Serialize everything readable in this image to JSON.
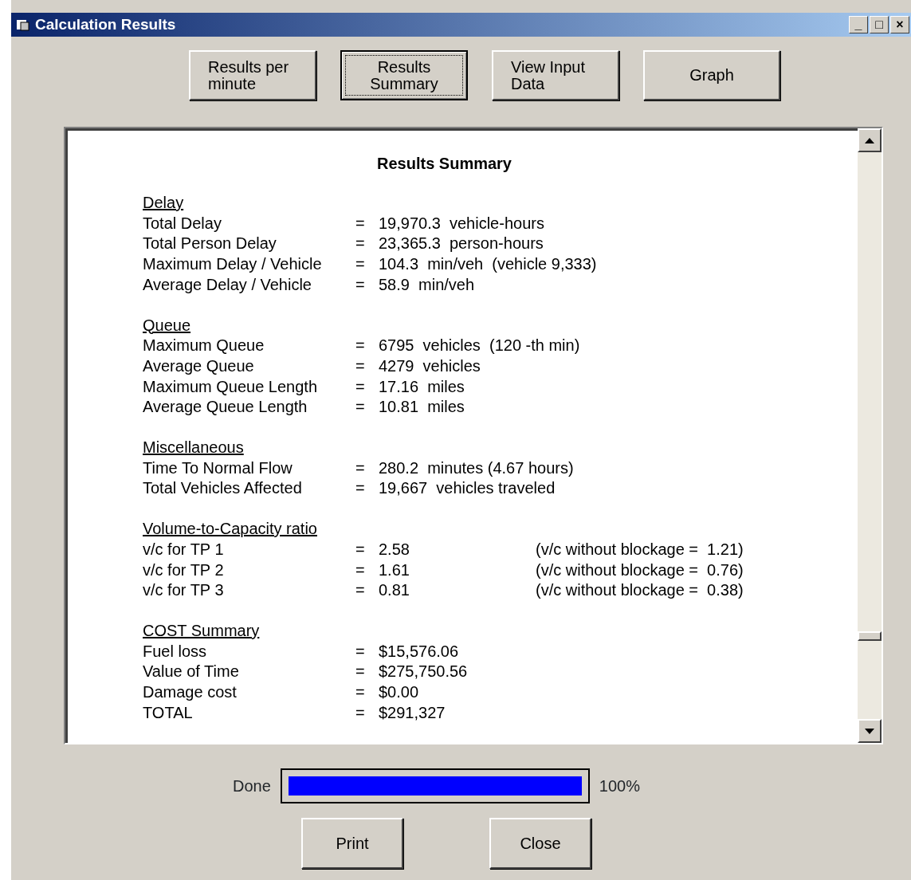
{
  "window": {
    "title": "Calculation Results",
    "controls": [
      "_",
      "□",
      "×"
    ]
  },
  "view_buttons": [
    {
      "label": "Results per minute",
      "selected": false
    },
    {
      "label": "Results Summary",
      "selected": true
    },
    {
      "label": "View Input Data",
      "selected": false
    },
    {
      "label": "Graph",
      "selected": false
    }
  ],
  "report": {
    "title": "Results Summary",
    "sections": [
      {
        "heading": "Delay",
        "rows": [
          {
            "label": "Total Delay",
            "sign": "=",
            "value": "19,970.3  vehicle-hours"
          },
          {
            "label": "Total Person Delay",
            "sign": "=",
            "value": "23,365.3  person-hours"
          },
          {
            "label": "Maximum Delay / Vehicle",
            "sign": "=",
            "value": "104.3  min/veh  (vehicle 9,333)"
          },
          {
            "label": "Average Delay / Vehicle",
            "sign": "=",
            "value": "58.9  min/veh"
          }
        ]
      },
      {
        "heading": "Queue",
        "rows": [
          {
            "label": "Maximum Queue",
            "sign": "=",
            "value": "6795  vehicles  (120 -th min)"
          },
          {
            "label": "Average Queue",
            "sign": "=",
            "value": "4279  vehicles"
          },
          {
            "label": "Maximum Queue Length",
            "sign": "=",
            "value": "17.16  miles"
          },
          {
            "label": "Average Queue Length",
            "sign": "=",
            "value": "10.81  miles"
          }
        ]
      },
      {
        "heading": "Miscellaneous",
        "rows": [
          {
            "label": "Time To Normal Flow",
            "sign": "=",
            "value": "280.2  minutes (4.67 hours)"
          },
          {
            "label": "Total Vehicles Affected",
            "sign": "=",
            "value": "19,667  vehicles traveled"
          }
        ]
      },
      {
        "heading": "Volume-to-Capacity ratio",
        "rows": [
          {
            "label": "v/c for TP 1",
            "sign": "=",
            "value": "2.58",
            "note": "(v/c without blockage =  1.21)"
          },
          {
            "label": "v/c for TP 2",
            "sign": "=",
            "value": "1.61",
            "note": "(v/c without blockage =  0.76)"
          },
          {
            "label": "v/c for TP 3",
            "sign": "=",
            "value": "0.81",
            "note": "(v/c without blockage =  0.38)"
          }
        ]
      },
      {
        "heading": "COST Summary",
        "rows": [
          {
            "label": "Fuel loss",
            "sign": "=",
            "value": "$15,576.06"
          },
          {
            "label": "Value of Time",
            "sign": "=",
            "value": "$275,750.56"
          },
          {
            "label": "Damage cost",
            "sign": "=",
            "value": "$0.00"
          },
          {
            "label": "TOTAL",
            "sign": "=",
            "value": "$291,327"
          }
        ]
      }
    ]
  },
  "progress": {
    "label": "Done",
    "level": 1,
    "reading": "100%"
  },
  "action_buttons": [
    "Print",
    "Close"
  ]
}
